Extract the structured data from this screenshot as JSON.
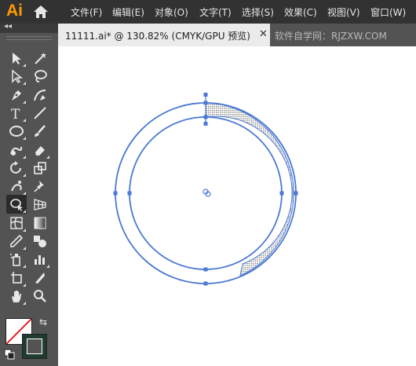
{
  "app": {
    "logo": "Ai"
  },
  "menu": [
    "文件(F)",
    "编辑(E)",
    "对象(O)",
    "文字(T)",
    "选择(S)",
    "效果(C)",
    "视图(V)",
    "窗口(W)"
  ],
  "document": {
    "tab_title": "11111.ai* @ 130.82% (CMYK/GPU 预览)",
    "close_glyph": "✕"
  },
  "watermark": "软件自学网：RJZXW.COM",
  "toolbar": {
    "collapse_glyph": "◂◂",
    "swap_glyph": "⇆"
  },
  "colors": {
    "selection": "#4a78d4",
    "menubar": "#323232",
    "panel": "#535353",
    "logo": "#ff9a00",
    "stroke_swatch": "#1e3d2f"
  },
  "icons": [
    "selection-icon",
    "magic-wand-icon",
    "direct-selection-icon",
    "lasso-icon",
    "pen-icon",
    "curvature-icon",
    "type-icon",
    "line-segment-icon",
    "ellipse-icon",
    "paintbrush-icon",
    "shaper-icon",
    "eraser-icon",
    "rotate-icon",
    "scale-icon",
    "puppet-warp-icon",
    "pin-icon",
    "shape-builder-icon",
    "perspective-grid-icon",
    "mesh-icon",
    "gradient-icon",
    "eyedropper-icon",
    "blend-icon",
    "symbol-sprayer-icon",
    "column-graph-icon",
    "artboard-icon",
    "slice-icon",
    "hand-icon",
    "zoom-icon"
  ]
}
